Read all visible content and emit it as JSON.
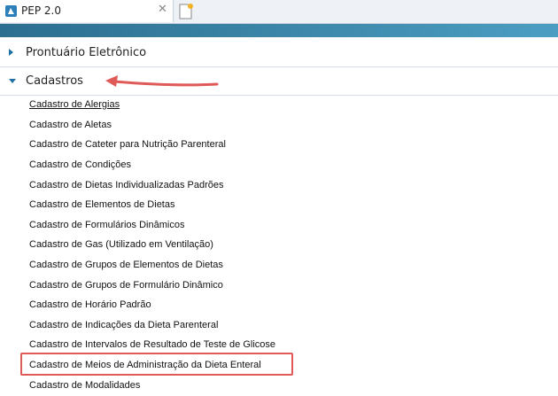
{
  "tab": {
    "title": "PEP 2.0",
    "close_glyph": "✕",
    "favicon": "pep-logo-icon",
    "new_tab_icon": "new-tab-icon"
  },
  "accent_colors": {
    "band_start": "#2c6e8f",
    "band_end": "#4b9ec2",
    "chevron": "#1e6fa5",
    "annotation_red": "#e05a5a"
  },
  "menu": {
    "sections": [
      {
        "label": "Prontuário Eletrônico",
        "expanded": false
      },
      {
        "label": "Cadastros",
        "expanded": true
      }
    ],
    "items": [
      "Cadastro de Alergias",
      "Cadastro de Aletas",
      "Cadastro de Cateter para Nutrição Parenteral",
      "Cadastro de Condições",
      "Cadastro de Dietas Individualizadas Padrões",
      "Cadastro de Elementos de Dietas",
      "Cadastro de Formulários Dinâmicos",
      "Cadastro de Gas (Utilizado em Ventilação)",
      "Cadastro de Grupos de Elementos de Dietas",
      "Cadastro de Grupos de Formulário Dinâmico",
      "Cadastro de Horário Padrão",
      "Cadastro de Indicações da Dieta Parenteral",
      "Cadastro de Intervalos de Resultado de Teste de Glicose",
      "Cadastro de Meios de Administração da Dieta Enteral",
      "Cadastro de Modalidades"
    ],
    "underlined_item_index": 0,
    "highlighted_item_index": 13
  }
}
